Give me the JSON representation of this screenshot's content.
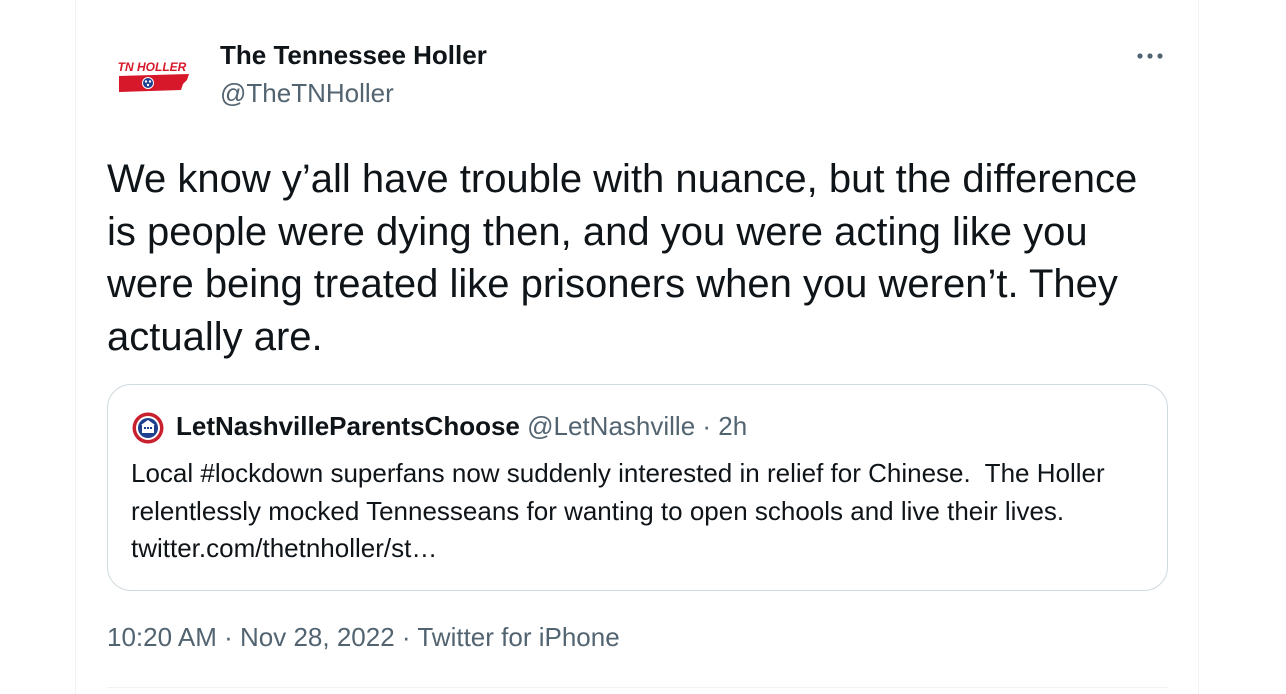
{
  "tweet": {
    "author": {
      "display_name": "The Tennessee Holler",
      "handle": "@TheTNHoller",
      "avatar_logo_text": "TN HOLLER"
    },
    "more_icon": "more-horizontal-icon",
    "text": "We know y’all have trouble with nuance, but the difference is people were dying then, and you were acting like you were being treated like prisoners when you weren’t. They actually are.",
    "quote": {
      "display_name": "LetNashvilleParentsChoose",
      "handle": "@LetNashville",
      "separator": "·",
      "time": "2h",
      "text": "Local #lockdown superfans now suddenly interested in relief for Chinese.  The Holler relentlessly mocked Tennesseans for wanting to open schools and live their lives. twitter.com/thetnholler/st…"
    },
    "meta": {
      "time": "10:20 AM",
      "date": "Nov 28, 2022",
      "source": "Twitter for iPhone",
      "separator": "·"
    }
  },
  "colors": {
    "text_primary": "#0f1419",
    "text_secondary": "#536471",
    "border": "#cfd9de",
    "logo_red": "#d7182a",
    "logo_blue": "#1d3f8f"
  }
}
